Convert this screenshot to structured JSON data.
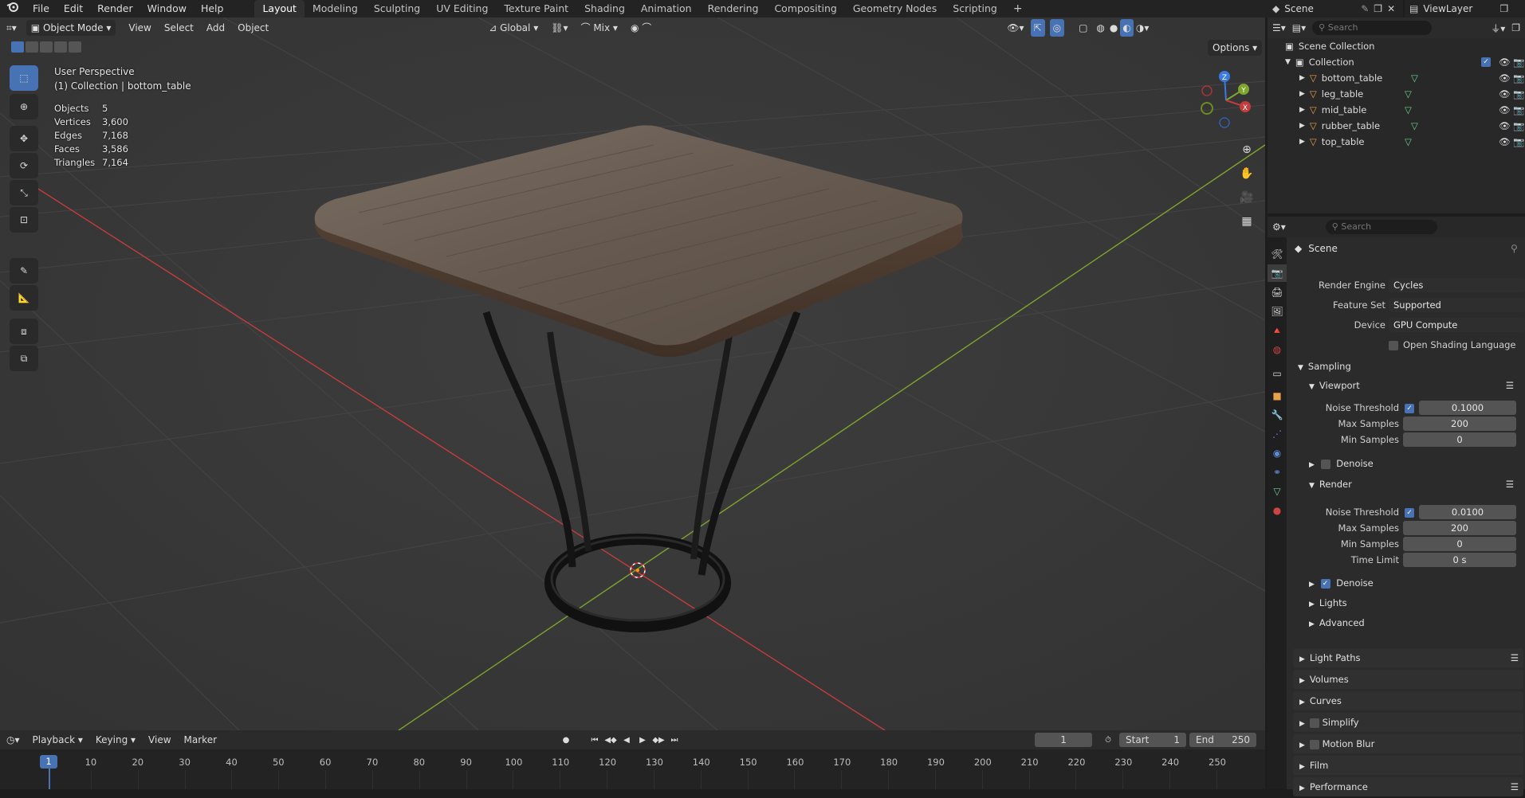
{
  "app_menu": [
    "File",
    "Edit",
    "Render",
    "Window",
    "Help"
  ],
  "workspaces": [
    "Layout",
    "Modeling",
    "Sculpting",
    "UV Editing",
    "Texture Paint",
    "Shading",
    "Animation",
    "Rendering",
    "Compositing",
    "Geometry Nodes",
    "Scripting"
  ],
  "active_workspace": "Layout",
  "add_workspace": "+",
  "scene_name": "Scene",
  "view_layer": "ViewLayer",
  "viewport": {
    "mode": "Object Mode",
    "menus": [
      "View",
      "Select",
      "Add",
      "Object"
    ],
    "transform_orientation": "Global",
    "snap_mode": "Mix",
    "options_label": "Options",
    "perspective": "User Perspective",
    "context": "(1) Collection | bottom_table",
    "stats": [
      {
        "label": "Objects",
        "value": "5"
      },
      {
        "label": "Vertices",
        "value": "3,600"
      },
      {
        "label": "Edges",
        "value": "7,168"
      },
      {
        "label": "Faces",
        "value": "3,586"
      },
      {
        "label": "Triangles",
        "value": "7,164"
      }
    ],
    "gizmo_axes": {
      "x": "X",
      "y": "Y",
      "z": "Z"
    }
  },
  "outliner": {
    "search_placeholder": "Search",
    "root": "Scene Collection",
    "collection": "Collection",
    "objects": [
      "bottom_table",
      "leg_table",
      "mid_table",
      "rubber_table",
      "top_table"
    ]
  },
  "properties": {
    "search_placeholder": "Search",
    "context": "Scene",
    "render_engine_label": "Render Engine",
    "render_engine": "Cycles",
    "feature_set_label": "Feature Set",
    "feature_set": "Supported",
    "device_label": "Device",
    "device": "GPU Compute",
    "osl_label": "Open Shading Language",
    "sampling": "Sampling",
    "viewport_section": "Viewport",
    "viewport_noise_threshold_label": "Noise Threshold",
    "viewport_noise_threshold": "0.1000",
    "viewport_max_samples_label": "Max Samples",
    "viewport_max_samples": "200",
    "viewport_min_samples_label": "Min Samples",
    "viewport_min_samples": "0",
    "viewport_denoise_label": "Denoise",
    "render_section": "Render",
    "render_noise_threshold_label": "Noise Threshold",
    "render_noise_threshold": "0.0100",
    "render_max_samples_label": "Max Samples",
    "render_max_samples": "200",
    "render_min_samples_label": "Min Samples",
    "render_min_samples": "0",
    "time_limit_label": "Time Limit",
    "time_limit": "0 s",
    "render_denoise_label": "Denoise",
    "lights": "Lights",
    "advanced": "Advanced",
    "panels": [
      "Light Paths",
      "Volumes",
      "Curves",
      "Simplify",
      "Motion Blur",
      "Film",
      "Performance"
    ]
  },
  "timeline": {
    "menus": [
      "Playback",
      "Keying",
      "View",
      "Marker"
    ],
    "current_frame": "1",
    "start_label": "Start",
    "start": "1",
    "end_label": "End",
    "end": "250",
    "ticks": [
      "1",
      "10",
      "20",
      "30",
      "40",
      "50",
      "60",
      "70",
      "80",
      "90",
      "100",
      "110",
      "120",
      "130",
      "140",
      "150",
      "160",
      "170",
      "180",
      "190",
      "200",
      "210",
      "220",
      "230",
      "240",
      "250"
    ]
  },
  "colors": {
    "accent": "#4772b3",
    "axis_x": "#c43c3c",
    "axis_y": "#7ea52c",
    "axis_z": "#3b7ae0",
    "object_orange": "#e8a24a",
    "mesh_green": "#6bcf8e"
  }
}
